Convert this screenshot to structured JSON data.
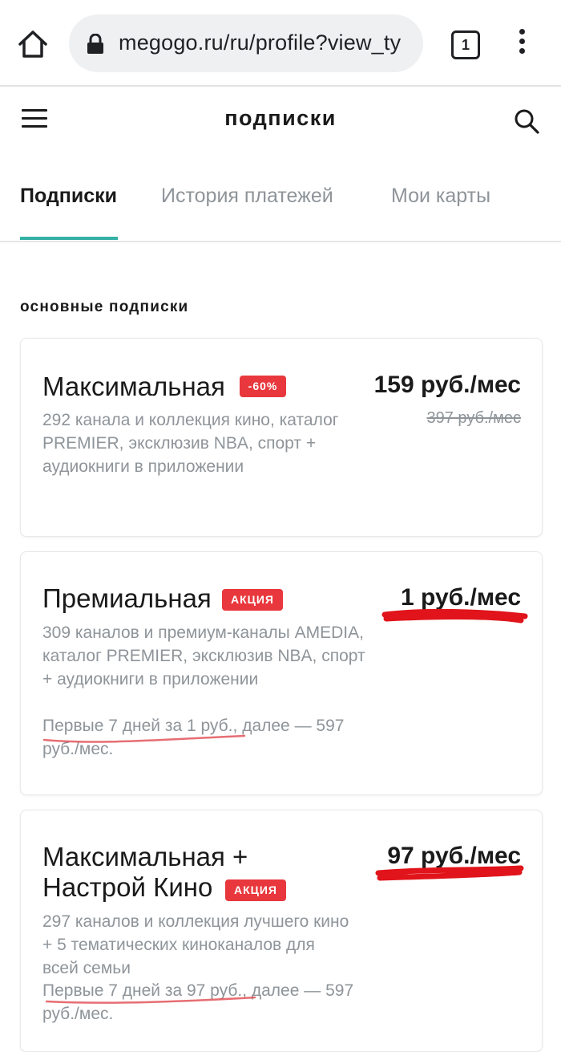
{
  "browser": {
    "url": "megogo.ru/ru/profile?view_ty",
    "tab_count": "1",
    "icons": {
      "home": "home-icon",
      "lock": "lock-icon",
      "tabs": "tab-switcher-icon",
      "menu": "more-vert-icon"
    }
  },
  "header": {
    "title": "подписки",
    "icons": {
      "menu": "hamburger-menu-icon",
      "search": "search-icon"
    }
  },
  "tabs": [
    {
      "label": "Подписки",
      "active": true
    },
    {
      "label": "История платежей",
      "active": false
    },
    {
      "label": "Мои карты",
      "active": false
    }
  ],
  "section_title": "основные подписки",
  "plans": [
    {
      "name": "Максимальная",
      "badge": "-60%",
      "price": "159 руб./мес",
      "old_price": "397 руб./мес",
      "description": "292 канала и коллекция кино, каталог PREMIER, эксклюзив NBA, спорт + аудиокниги в приложении"
    },
    {
      "name": "Премиальная",
      "badge": "АКЦИЯ",
      "price": "1 руб./мес",
      "description": "309 каналов и премиум-каналы AMEDIA, каталог PREMIER, эксклюзив NBA, спорт + аудиокниги в приложении",
      "promo": "Первые 7 дней за 1 руб., далее — 597 руб./мес."
    },
    {
      "name_line1": "Максимальная +",
      "name_line2": "Настрой Кино",
      "badge": "АКЦИЯ",
      "price": "97 руб./мес",
      "description": "297 каналов и коллекция лучшего кино + 5 тематических киноканалов для всей семьи",
      "promo": "Первые 7 дней за 97 руб., далее — 597 руб./мес."
    }
  ],
  "colors": {
    "accent_teal": "#35b0a5",
    "badge_red": "#e8383d",
    "annotation_red": "#e0141a",
    "muted_text": "#8e9499"
  }
}
